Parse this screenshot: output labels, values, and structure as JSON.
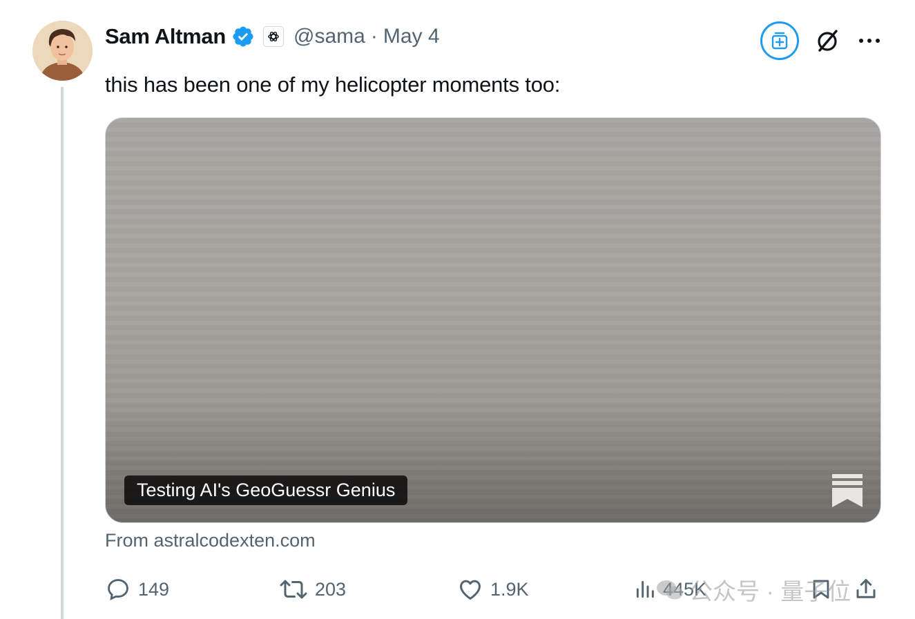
{
  "author": {
    "name": "Sam Altman",
    "handle": "@sama",
    "separator": "·",
    "date": "May 4"
  },
  "tweet": {
    "text": "this has been one of my helicopter moments too:"
  },
  "card": {
    "title": "Testing AI's GeoGuessr Genius",
    "source": "From astralcodexten.com"
  },
  "actions": {
    "replies": "149",
    "reposts": "203",
    "likes": "1.9K",
    "views": "445K"
  },
  "watermark": {
    "text": "公众号 · 量子位"
  },
  "colors": {
    "accent": "#1d9bf0",
    "secondary_text": "#536471",
    "thread_line": "#cfd9de"
  }
}
